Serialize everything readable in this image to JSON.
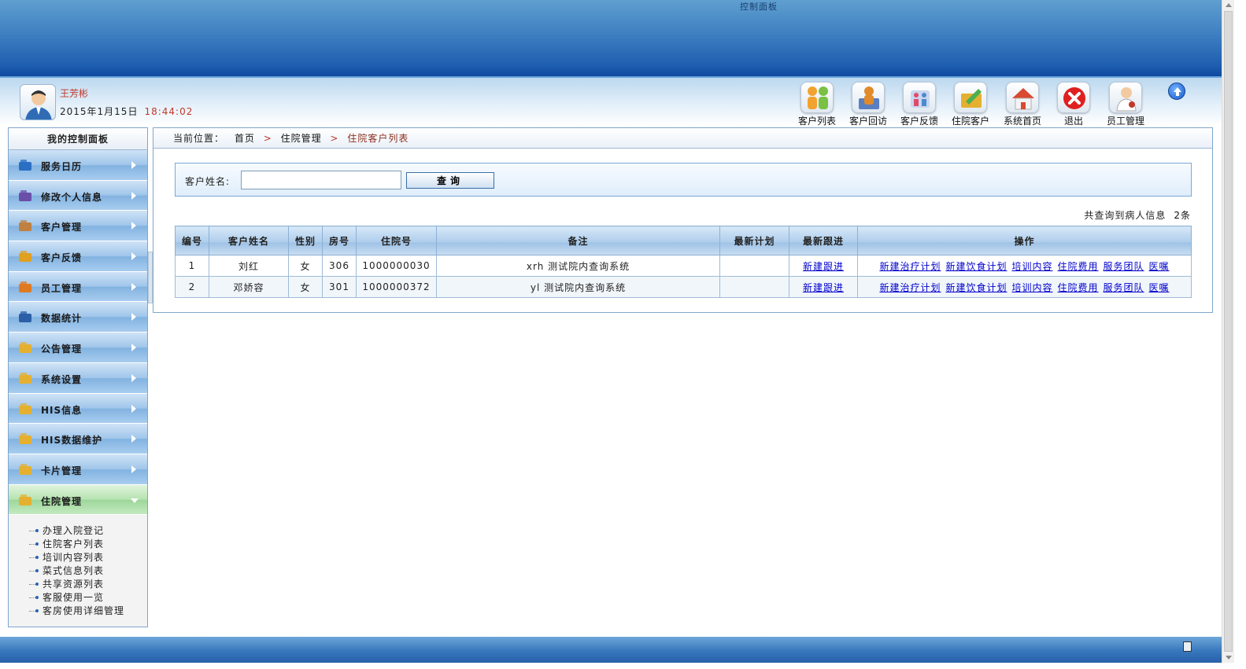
{
  "banner": {
    "title": "控制面板"
  },
  "user": {
    "name": "王芳彬",
    "date": "2015年1月15日",
    "time": "18:44:02"
  },
  "toolbar": [
    {
      "label": "客户列表",
      "icon": "people-icon",
      "color": "#f2a230"
    },
    {
      "label": "客户回访",
      "icon": "visit-icon",
      "color": "#e08a2a"
    },
    {
      "label": "客户反馈",
      "icon": "feedback-icon",
      "color": "#6a8fd0"
    },
    {
      "label": "住院客户",
      "icon": "inpatient-icon",
      "color": "#d9a030"
    },
    {
      "label": "系统首页",
      "icon": "home-icon",
      "color": "#d94a30"
    },
    {
      "label": "退出",
      "icon": "exit-icon",
      "color": "#e02020"
    },
    {
      "label": "员工管理",
      "icon": "staff-icon",
      "color": "#c0392b"
    }
  ],
  "sidebar": {
    "title": "我的控制面板",
    "items": [
      {
        "label": "服务日历",
        "icon": "clock-icon",
        "color": "#2b6fc4"
      },
      {
        "label": "修改个人信息",
        "icon": "person-edit-icon",
        "color": "#6a4fa8"
      },
      {
        "label": "客户管理",
        "icon": "person-icon",
        "color": "#c08040"
      },
      {
        "label": "客户反馈",
        "icon": "feedback-card-icon",
        "color": "#e0a020"
      },
      {
        "label": "员工管理",
        "icon": "staff-group-icon",
        "color": "#e07a20"
      },
      {
        "label": "数据统计",
        "icon": "monitor-icon",
        "color": "#2b5fa8"
      },
      {
        "label": "公告管理",
        "icon": "folder-icon",
        "color": "#e5b030"
      },
      {
        "label": "系统设置",
        "icon": "folder-icon",
        "color": "#e5b030"
      },
      {
        "label": "HIS信息",
        "icon": "folder-icon",
        "color": "#e5b030"
      },
      {
        "label": "HIS数据维护",
        "icon": "folder-icon",
        "color": "#e5b030"
      },
      {
        "label": "卡片管理",
        "icon": "folder-icon",
        "color": "#e5b030"
      },
      {
        "label": "住院管理",
        "icon": "folder-icon",
        "color": "#e5b030",
        "active": true
      }
    ],
    "submenu": [
      "办理入院登记",
      "住院客户列表",
      "培训内容列表",
      "菜式信息列表",
      "共享资源列表",
      "客服使用一览",
      "客房使用详细管理"
    ]
  },
  "breadcrumb": {
    "prefix": "当前位置：",
    "home": "首页",
    "section": "住院管理",
    "current": "住院客户列表",
    "sep": ">"
  },
  "search": {
    "label": "客户姓名:",
    "value": "",
    "placeholder": "",
    "button": "查询"
  },
  "summary": {
    "text": "共查询到病人信息",
    "count": "2条"
  },
  "table": {
    "headers": [
      "编号",
      "客户姓名",
      "性别",
      "房号",
      "住院号",
      "备注",
      "最新计划",
      "最新跟进",
      "操作"
    ],
    "rows": [
      {
        "id": "1",
        "name": "刘红",
        "gender": "女",
        "room": "306",
        "admission": "1000000030",
        "note": "xrh 测试院内查询系统",
        "plan": "",
        "follow": "新建跟进"
      },
      {
        "id": "2",
        "name": "邓娇容",
        "gender": "女",
        "room": "301",
        "admission": "1000000372",
        "note": "yl 测试院内查询系统",
        "plan": "",
        "follow": "新建跟进"
      }
    ],
    "actions": [
      "新建治疗计划",
      "新建饮食计划",
      "培训内容",
      "住院费用",
      "服务团队",
      "医嘱"
    ]
  },
  "colors": {
    "accent": "#1f5fb0",
    "highlight": "#c0392b",
    "link": "#0000cc",
    "active_menu": "#9dd69a"
  }
}
